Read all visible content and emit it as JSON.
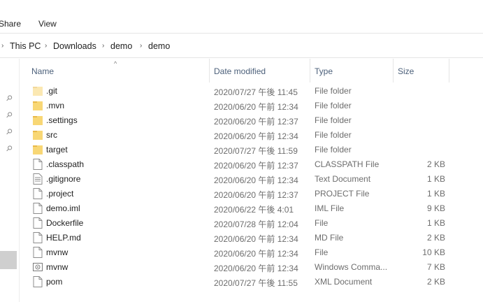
{
  "ribbon": {
    "share_label": "Share",
    "view_label": "View"
  },
  "address": {
    "crumbs": [
      "This PC",
      "Downloads",
      "demo",
      "demo"
    ],
    "separator": "›"
  },
  "columns": {
    "name": "Name",
    "date": "Date modified",
    "type": "Type",
    "size": "Size",
    "sort_indicator": "^"
  },
  "files": [
    {
      "name": ".git",
      "date": "2020/07/27 午後 11:45",
      "type": "File folder",
      "size": "",
      "icon": "folder-icon"
    },
    {
      "name": ".mvn",
      "date": "2020/06/20 午前 12:34",
      "type": "File folder",
      "size": "",
      "icon": "folder-icon"
    },
    {
      "name": ".settings",
      "date": "2020/06/20 午前 12:37",
      "type": "File folder",
      "size": "",
      "icon": "folder-icon"
    },
    {
      "name": "src",
      "date": "2020/06/20 午前 12:34",
      "type": "File folder",
      "size": "",
      "icon": "folder-icon"
    },
    {
      "name": "target",
      "date": "2020/07/27 午後 11:59",
      "type": "File folder",
      "size": "",
      "icon": "folder-icon"
    },
    {
      "name": ".classpath",
      "date": "2020/06/20 午前 12:37",
      "type": "CLASSPATH File",
      "size": "2 KB",
      "icon": "file-icon"
    },
    {
      "name": ".gitignore",
      "date": "2020/06/20 午前 12:34",
      "type": "Text Document",
      "size": "1 KB",
      "icon": "text-file-icon"
    },
    {
      "name": ".project",
      "date": "2020/06/20 午前 12:37",
      "type": "PROJECT File",
      "size": "1 KB",
      "icon": "file-icon"
    },
    {
      "name": "demo.iml",
      "date": "2020/06/22 午後 4:01",
      "type": "IML File",
      "size": "9 KB",
      "icon": "file-icon"
    },
    {
      "name": "Dockerfile",
      "date": "2020/07/28 午前 12:04",
      "type": "File",
      "size": "1 KB",
      "icon": "file-icon"
    },
    {
      "name": "HELP.md",
      "date": "2020/06/20 午前 12:34",
      "type": "MD File",
      "size": "2 KB",
      "icon": "file-icon"
    },
    {
      "name": "mvnw",
      "date": "2020/06/20 午前 12:34",
      "type": "File",
      "size": "10 KB",
      "icon": "file-icon"
    },
    {
      "name": "mvnw",
      "date": "2020/06/20 午前 12:34",
      "type": "Windows Comma...",
      "size": "7 KB",
      "icon": "cmd-file-icon"
    },
    {
      "name": "pom",
      "date": "2020/07/27 午後 11:55",
      "type": "XML Document",
      "size": "2 KB",
      "icon": "file-icon"
    }
  ],
  "colors": {
    "folder": "#f8d775",
    "folder_light": "#fbeab4",
    "header_text": "#4c607a",
    "muted_text": "#6d6d6d"
  }
}
